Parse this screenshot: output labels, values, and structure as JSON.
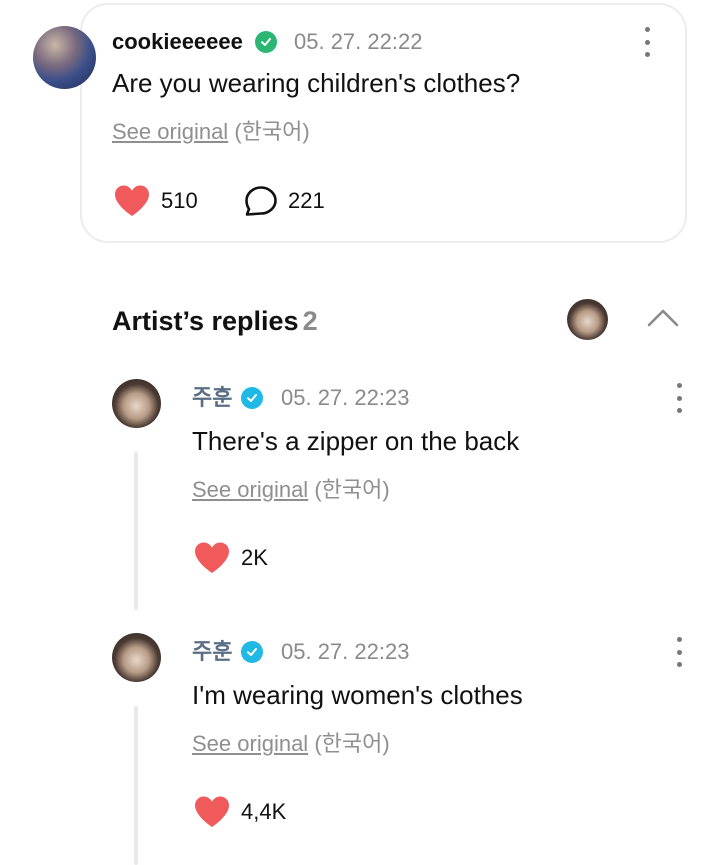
{
  "post": {
    "username": "cookieeeeee",
    "timestamp": "05. 27. 22:22",
    "text": "Are you wearing children's clothes?",
    "see_original": "See original",
    "language": "(한국어)",
    "likes": "510",
    "comments": "221",
    "verified_badge_color": "#2bb673",
    "icons": {
      "like": "heart-icon",
      "comment": "comment-bubble-icon",
      "more": "more-vertical-icon"
    }
  },
  "replies_section": {
    "title": "Artist’s replies",
    "count": "2",
    "toggle_icon": "chevron-up-icon"
  },
  "replies": [
    {
      "name": "주훈",
      "timestamp": "05. 27. 22:23",
      "text": "There's a zipper on the back",
      "see_original": "See original",
      "language": "(한국어)",
      "likes": "2K",
      "verified_badge_color": "#20b8e5"
    },
    {
      "name": "주훈",
      "timestamp": "05. 27. 22:23",
      "text": "I'm wearing women's clothes",
      "see_original": "See original",
      "language": "(한국어)",
      "likes": "4,4K",
      "verified_badge_color": "#20b8e5"
    }
  ],
  "colors": {
    "heart": "#f05a5a",
    "muted_text": "#8a8a8a",
    "artist_name": "#5a6f86"
  }
}
